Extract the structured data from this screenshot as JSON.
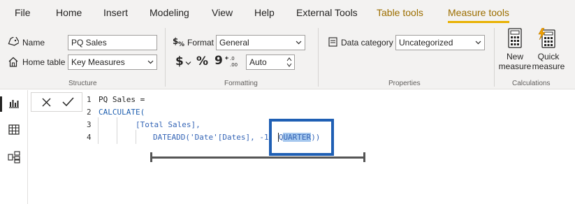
{
  "menu": {
    "items": [
      "File",
      "Home",
      "Insert",
      "Modeling",
      "View",
      "Help",
      "External Tools"
    ],
    "context_tabs": [
      "Table tools",
      "Measure tools"
    ],
    "active_tab": "Measure tools"
  },
  "ribbon": {
    "structure": {
      "label": "Structure",
      "name_label": "Name",
      "name_value": "PQ Sales",
      "home_table_label": "Home table",
      "home_table_value": "Key Measures"
    },
    "formatting": {
      "label": "Formatting",
      "format_label": "Format",
      "format_value": "General",
      "currency_symbol": "$",
      "percent_symbol": "%",
      "comma_symbol": "9",
      "decimals_value": "Auto"
    },
    "properties": {
      "label": "Properties",
      "data_category_label": "Data category",
      "data_category_value": "Uncategorized"
    },
    "calculations": {
      "label": "Calculations",
      "new_measure_label_1": "New",
      "new_measure_label_2": "measure",
      "quick_measure_label_1": "Quick",
      "quick_measure_label_2": "measure"
    }
  },
  "formula": {
    "line_numbers": [
      "1",
      "2",
      "3",
      "4"
    ],
    "line1": "PQ Sales =",
    "line2": "CALCULATE(",
    "line3": "[Total Sales],",
    "line4_prefix": "DATEADD('Date'[Dates], -1, ",
    "line4_cursor": "Q",
    "line4_selected": "UARTER",
    "line4_suffix": "))"
  },
  "colors": {
    "accent": "#e8b100",
    "highlight_box": "#1f5fb4",
    "code_blue": "#3565b6"
  },
  "icons": [
    "name-tag-icon",
    "home-icon",
    "format-icon",
    "dollar-icon",
    "percent-icon",
    "comma-icon",
    "decimal-icon",
    "data-category-icon",
    "new-measure-icon",
    "quick-measure-icon",
    "report-view-icon",
    "data-view-icon",
    "model-view-icon",
    "cancel-icon",
    "commit-icon"
  ]
}
